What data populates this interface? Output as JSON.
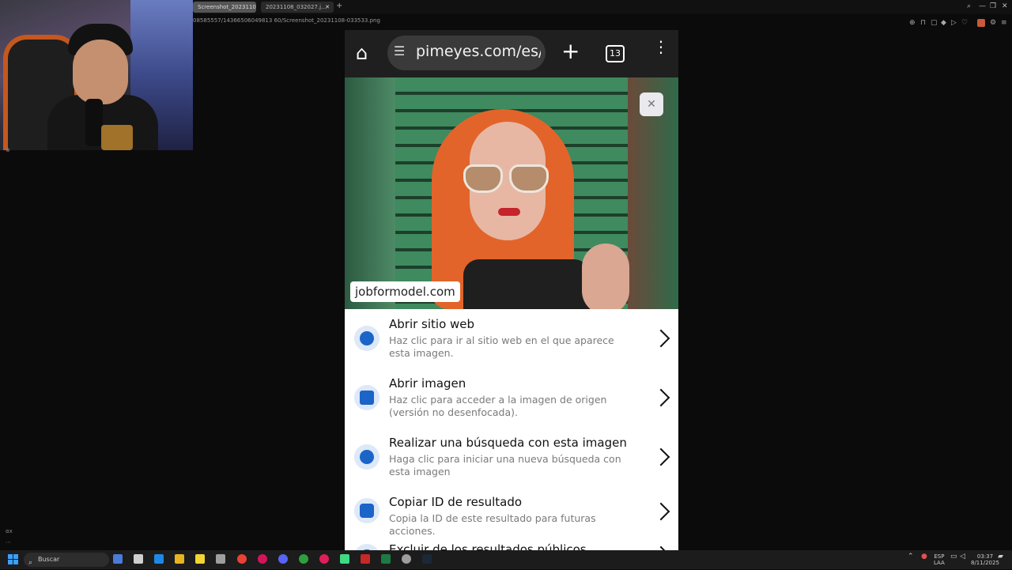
{
  "browser": {
    "tabs": [
      {
        "title": "Screenshot_20231108-0…"
      },
      {
        "title": "20231108_032027.j…"
      }
    ],
    "new_tab": "+",
    "address": "08585557/14366506049813 60/Screenshot_20231108-033533.png",
    "window_controls": [
      "⌕",
      "—",
      "❐",
      "✕"
    ]
  },
  "phone": {
    "url": "pimeyes.com/es/re",
    "tab_count": "13",
    "source_label": "jobformodel.com",
    "close_symbol": "✕",
    "items": [
      {
        "title": "Abrir sitio web",
        "desc": "Haz clic para ir al sitio web en el que aparece esta imagen.",
        "icon": "globe-icon"
      },
      {
        "title": "Abrir imagen",
        "desc": "Haz clic para acceder a la imagen de origen (versión no desenfocada).",
        "icon": "image-icon"
      },
      {
        "title": "Realizar una búsqueda con esta imagen",
        "desc": "Haga clic para iniciar una nueva búsqueda con esta imagen",
        "icon": "search-icon"
      },
      {
        "title": "Copiar ID de resultado",
        "desc": "Copia la ID de este resultado para futuras acciones.",
        "icon": "copy-icon"
      },
      {
        "title": "Excluir de los resultados públicos",
        "desc": "",
        "icon": "exclude-icon"
      }
    ]
  },
  "taskbar": {
    "search_placeholder": "Buscar",
    "lang_top": "ESP",
    "lang_bottom": "LAA",
    "time": "03:37",
    "date": "8/11/2025"
  },
  "colors": {
    "accent": "#1b64c8",
    "background": "#0b0b0b"
  }
}
